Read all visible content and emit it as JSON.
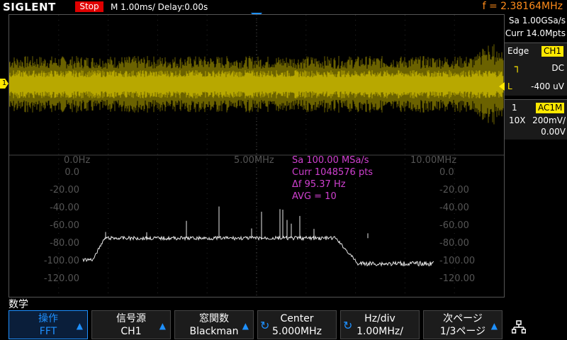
{
  "header": {
    "brand": "SIGLENT",
    "run_state": "Stop",
    "timebase": "M 1.00ms/ Delay:0.00s",
    "frequency": "f = 2.38164MHz"
  },
  "right_panel": {
    "sample_rate": "Sa 1.00GSa/s",
    "memory": "Curr 14.0Mpts",
    "trigger_type": "Edge",
    "trigger_source": "CH1",
    "trigger_coupling": "DC",
    "trigger_level_prefix": "L",
    "trigger_level": "-400 uV",
    "channel_number": "1",
    "channel_coupling": "AC1M",
    "probe": "10X",
    "volts_div": "200mV/",
    "offset": "0.00V"
  },
  "channel_marker": "1",
  "fft_info": {
    "sa": "Sa 100.00 MSa/s",
    "curr": "Curr 1048576 pts",
    "df": "Δf 95.37 Hz",
    "avg": "AVG = 10"
  },
  "fft_axis": {
    "x_labels": [
      "0.0Hz",
      "5.00MHz",
      "10.00MHz"
    ],
    "y_labels": [
      "0.0",
      "-20.00",
      "-40.00",
      "-60.00",
      "-80.00",
      "-100.00",
      "-120.00"
    ],
    "y_labels_right": [
      "0.0",
      "-20.00",
      "-40.00",
      "-60.00",
      "-80.00",
      "-100.00",
      "-120.00"
    ]
  },
  "menu": {
    "title": "数学",
    "keys": [
      {
        "line1": "操作",
        "line2": "FFT"
      },
      {
        "line1": "信号源",
        "line2": "CH1"
      },
      {
        "line1": "窓関数",
        "line2": "Blackman"
      },
      {
        "line1": "Center",
        "line2": "5.000MHz"
      },
      {
        "line1": "Hz/div",
        "line2": "1.00MHz/"
      },
      {
        "line1": "次ページ",
        "line2": "1/3ページ"
      }
    ]
  },
  "colors": {
    "ch1": "#ffe800",
    "math": "#d040d0",
    "accent": "#1e90ff",
    "stop": "#e00000",
    "freq": "#ff8c1a"
  }
}
